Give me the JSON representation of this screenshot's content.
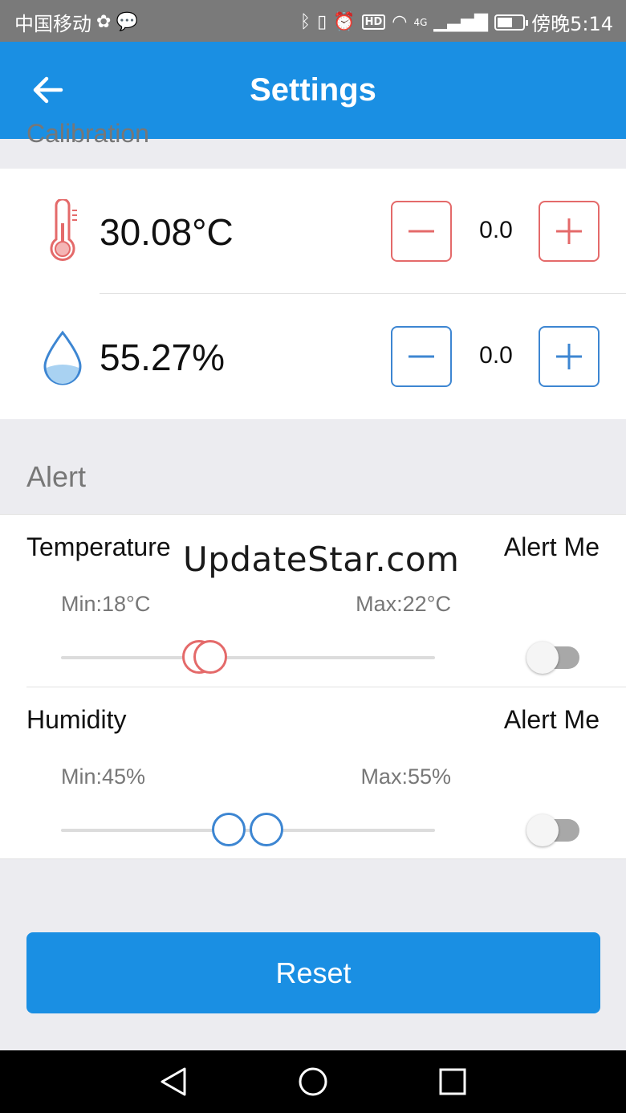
{
  "status_bar": {
    "carrier": "中国移动",
    "time": "傍晚5:14",
    "hd_badge": "HD",
    "network": "4G"
  },
  "app_bar": {
    "title": "Settings"
  },
  "calibration": {
    "section_title": "Calibration",
    "temperature": {
      "reading": "30.08°C",
      "offset": "0.0",
      "color": "#e46a6a"
    },
    "humidity": {
      "reading": "55.27%",
      "offset": "0.0",
      "color": "#3d86d2"
    }
  },
  "alert": {
    "section_title": "Alert",
    "temperature": {
      "label": "Temperature",
      "alert_me": "Alert Me",
      "min_label": "Min:18°C",
      "max_label": "Max:22°C",
      "alert_enabled": false
    },
    "humidity": {
      "label": "Humidity",
      "alert_me": "Alert Me",
      "min_label": "Min:45%",
      "max_label": "Max:55%",
      "alert_enabled": false
    }
  },
  "watermark": "UpdateStar.com",
  "reset_label": "Reset",
  "colors": {
    "primary": "#1a8fe3",
    "temperature": "#e46a6a",
    "humidity": "#3d86d2"
  }
}
